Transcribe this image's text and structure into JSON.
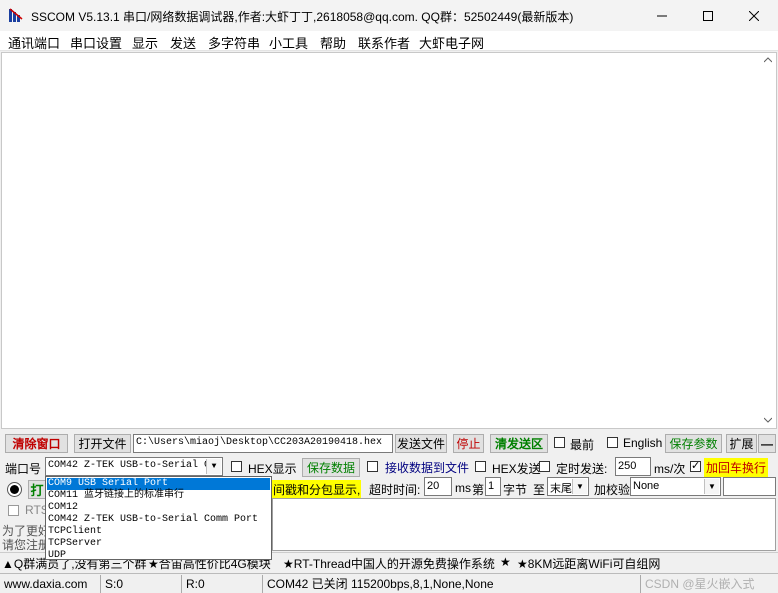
{
  "window": {
    "title": "SSCOM V5.13.1 串口/网络数据调试器,作者:大虾丁丁,2618058@qq.com. QQ群：52502449(最新版本)"
  },
  "menu": [
    "通讯端口",
    "串口设置",
    "显示",
    "发送",
    "多字符串",
    "小工具",
    "帮助",
    "联系作者",
    "大虾电子网"
  ],
  "toolbar1": {
    "clear_window": "清除窗口",
    "open_file": "打开文件",
    "file_path": "C:\\Users\\miaoj\\Desktop\\CC203A20190418.hex",
    "send_file": "发送文件",
    "stop": "停止",
    "clear_send": "清发送区",
    "topmost_label": "最前",
    "english_label": "English",
    "save_params": "保存参数",
    "expand": "扩展",
    "collapse": "—"
  },
  "toolbar2": {
    "port_label": "端口号",
    "port_value": "COM42 Z-TEK USB-to-Serial C",
    "hex_display": "HEX显示",
    "save_data": "保存数据",
    "receive_to_file": "接收数据到文件",
    "hex_send": "HEX发送",
    "timed_send": "定时发送:",
    "interval_value": "250",
    "interval_unit": "ms/次",
    "add_crlf": "加回车换行"
  },
  "toolbar3": {
    "open_button_partial": "打",
    "timestamp_label": "间戳和分包显示,",
    "timeout_label": "超时时间:",
    "timeout_value": "20",
    "timeout_unit": "ms",
    "nth_label": "第",
    "nth_value": "1",
    "byte_label": "字节",
    "to_label": "至",
    "end_value": "末尾",
    "checksum_label": "加校验",
    "checksum_value": "None"
  },
  "toolbar4": {
    "rts_label": "RTS"
  },
  "left_notes": {
    "line1": "为了更好",
    "line2": "请您注册"
  },
  "port_dropdown": {
    "items": [
      "COM9 USB Serial Port",
      "COM11 蓝牙链接上的标准串行",
      "COM12",
      "COM42 Z-TEK USB-to-Serial Comm Port",
      "TCPClient",
      "TCPServer",
      "UDP"
    ],
    "selected_index": 0
  },
  "ticker": {
    "prefix": "▲Q群满员了,没有第三个群",
    "part2": "★合宙高性价比4G模块",
    "part3": "★RT-Thread中国人的开源免费操作系统",
    "part4": "★",
    "part5": "★8KM远距离WiFi可自组网"
  },
  "statusbar": {
    "website": "www.daxia.com",
    "sent": "S:0",
    "received": "R:0",
    "port_status": "COM42 已关闭  115200bps,8,1,None,None",
    "watermark": "CSDN @星火嵌入式"
  },
  "colors": {
    "accent_red": "#c00000",
    "accent_green": "#008000",
    "highlight_yellow": "#ffff00",
    "selection_blue": "#0078d7"
  }
}
